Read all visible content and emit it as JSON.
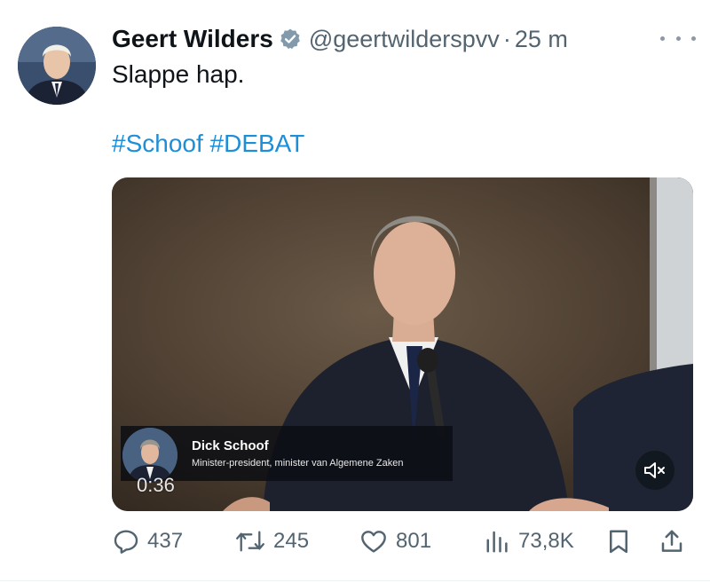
{
  "tweet": {
    "author_name": "Geert Wilders",
    "handle": "@geertwilderspvv",
    "separator": "·",
    "time": "25 m",
    "text": "Slappe hap.",
    "hashtags": [
      "#Schoof",
      "#DEBAT"
    ]
  },
  "video": {
    "speaker_name": "Dick Schoof",
    "speaker_role": "Minister-president, minister van Algemene Zaken",
    "duration": "0:36"
  },
  "actions": {
    "replies": "437",
    "reposts": "245",
    "likes": "801",
    "views": "73,8K"
  },
  "colors": {
    "link": "#1d9bf0",
    "muted_text": "#536471",
    "verified_badge": "#829aab"
  }
}
